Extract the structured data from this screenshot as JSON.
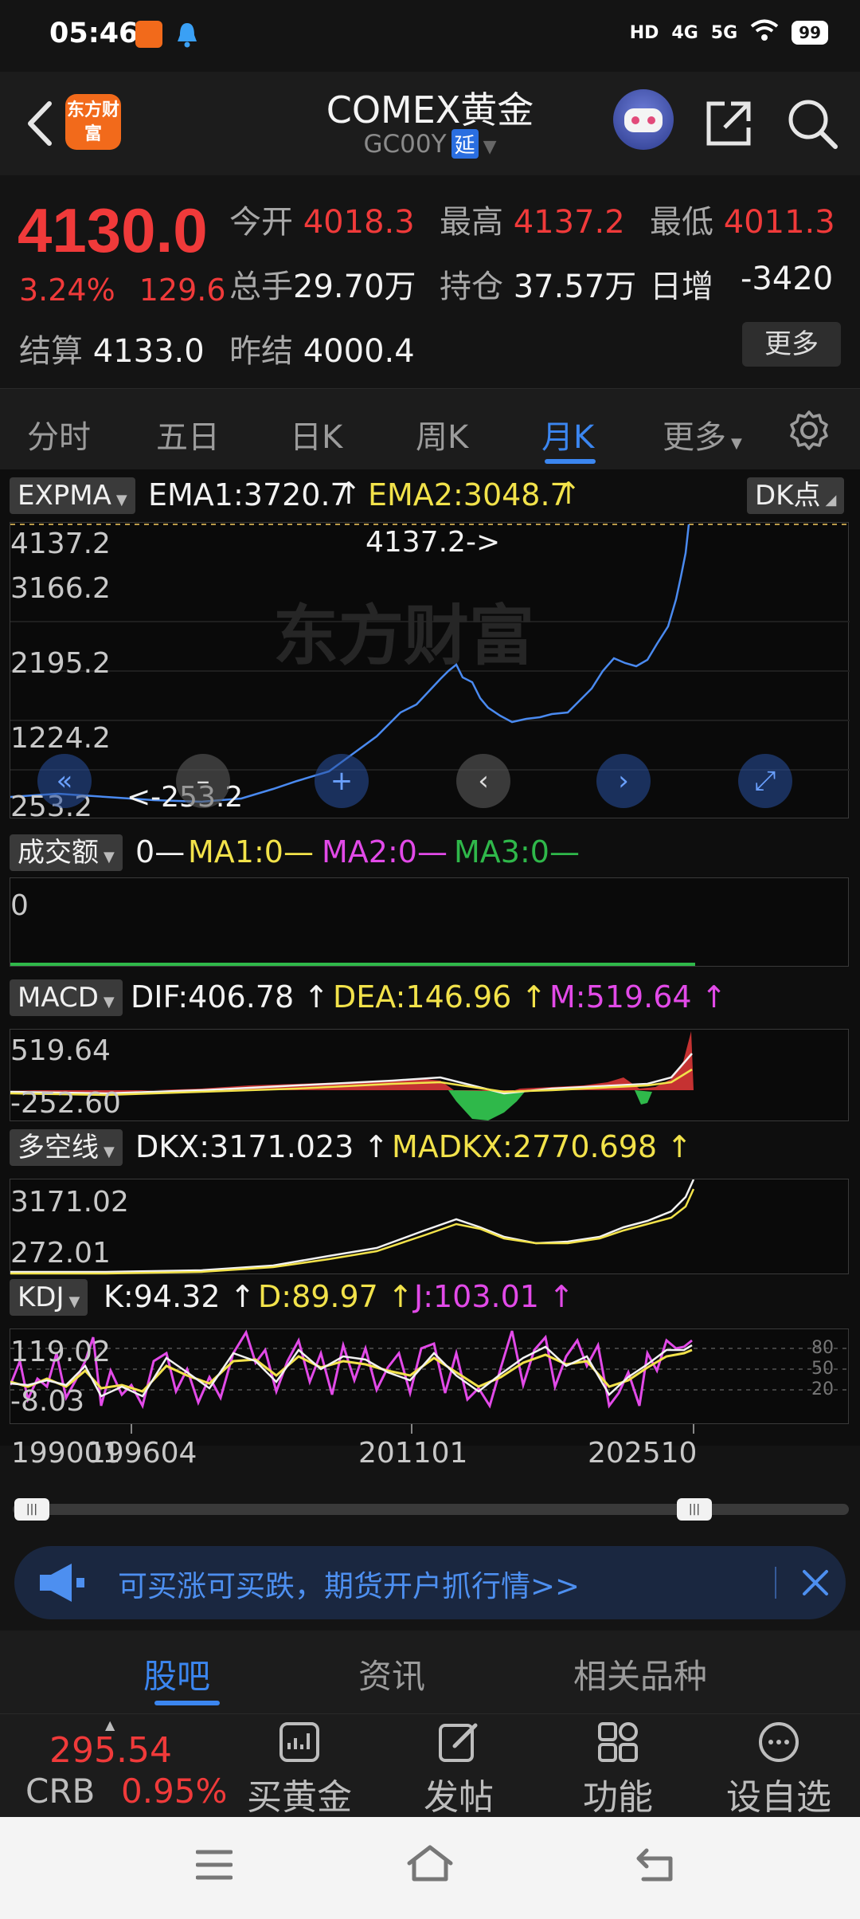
{
  "status_bar": {
    "time": "05:46",
    "network_labels": [
      "HD",
      "4G",
      "5G"
    ],
    "battery": "99"
  },
  "header": {
    "title": "COMEX黄金",
    "subtitle": "GC00Y",
    "delay_tag": "延",
    "logo_text": "东方财富"
  },
  "quote": {
    "last_price": "4130.0",
    "change_pct": "3.24%",
    "change_abs": "129.6",
    "open_label": "今开",
    "open": "4018.3",
    "high_label": "最高",
    "high": "4137.2",
    "low_label": "最低",
    "low": "4011.3",
    "volume_label": "总手",
    "volume": "29.70万",
    "oi_label": "持仓",
    "oi": "37.57万",
    "daily_inc_label": "日增",
    "daily_inc": "-3420",
    "settle_label": "结算",
    "settle": "4133.0",
    "prev_settle_label": "昨结",
    "prev_settle": "4000.4",
    "more_label": "更多"
  },
  "period_tabs": [
    "分时",
    "五日",
    "日K",
    "周K",
    "月K",
    "更多"
  ],
  "active_period": "月K",
  "chart": {
    "main": {
      "indicator": "EXPMA",
      "ema1": "EMA1:3720.7",
      "ema2": "EMA2:3048.7",
      "dk_label": "DK点",
      "y_ticks": [
        "4137.2",
        "3166.2",
        "2195.2",
        "1224.2",
        "253.2"
      ],
      "max_annotation": "4137.2->",
      "min_annotation": "<-253.2",
      "watermark": "东方财富"
    },
    "volume": {
      "indicator": "成交额",
      "v0": "0",
      "ma1": "MA1:0",
      "ma2": "MA2:0",
      "ma3": "MA3:0",
      "y_tick": "0"
    },
    "macd": {
      "indicator": "MACD",
      "dif": "DIF:406.78",
      "dea": "DEA:146.96",
      "m": "M:519.64",
      "y_ticks": [
        "519.64",
        "-252.60"
      ]
    },
    "dkx": {
      "indicator": "多空线",
      "dkx": "DKX:3171.023",
      "madkx": "MADKX:2770.698",
      "y_ticks": [
        "3171.02",
        "272.01"
      ]
    },
    "kdj": {
      "indicator": "KDJ",
      "k": "K:94.32",
      "d": "D:89.97",
      "j": "J:103.01",
      "y_ticks": [
        "119.02",
        "-8.03"
      ],
      "ref_levels": [
        "80",
        "50",
        "20"
      ]
    },
    "x_ticks": [
      "199001",
      "199604",
      "201101",
      "202510"
    ]
  },
  "banner": {
    "text": "可买涨可买跌，期货开户抓行情>>"
  },
  "bottom_tabs": [
    "股吧",
    "资讯",
    "相关品种"
  ],
  "active_bottom_tab": "股吧",
  "crb": {
    "price": "295.54",
    "name": "CRB",
    "change": "0.95%"
  },
  "actions": [
    "买黄金",
    "发帖",
    "功能",
    "设自选"
  ],
  "colors": {
    "up": "#f03a3a",
    "accent": "#3b86f0",
    "ema1": "#f2f2f2",
    "ema2": "#f2e24a",
    "macd_dea": "#f2e24a",
    "kdj_j": "#e24ae8"
  }
}
